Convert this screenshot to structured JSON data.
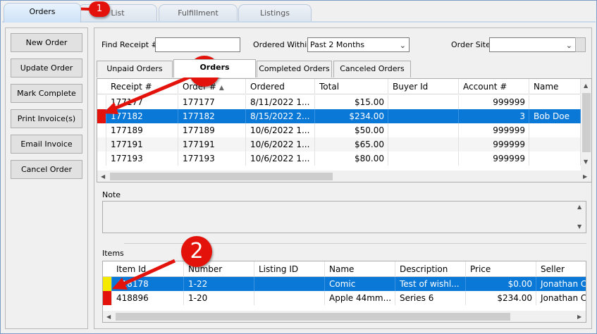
{
  "top_tabs": [
    "Orders",
    "List",
    "Fulfillment",
    "Listings"
  ],
  "left_buttons": [
    "New Order",
    "Update Order",
    "Mark Complete",
    "Print Invoice(s)",
    "Email Invoice",
    "Cancel Order"
  ],
  "filters": {
    "find_receipt_label": "Find Receipt #",
    "find_receipt_value": "",
    "ordered_within_label": "Ordered Within",
    "ordered_within_value": "Past 2 Months",
    "order_site_label": "Order Site",
    "order_site_value": ""
  },
  "order_tabs": [
    "Unpaid Orders",
    "Orders",
    "Completed Orders",
    "Canceled Orders"
  ],
  "orders_columns": [
    "Receipt #",
    "Order #",
    "Ordered",
    "Total",
    "Buyer Id",
    "Account #",
    "Name"
  ],
  "orders_rows": [
    {
      "receipt": "177177",
      "order": "177177",
      "ordered": "8/11/2022 1...",
      "total": "$15.00",
      "buyer": "",
      "account": "999999",
      "name": ""
    },
    {
      "receipt": "177182",
      "order": "177182",
      "ordered": "8/15/2022 2...",
      "total": "$234.00",
      "buyer": "",
      "account": "3",
      "name": "Bob Doe"
    },
    {
      "receipt": "177189",
      "order": "177189",
      "ordered": "10/6/2022 1...",
      "total": "$50.00",
      "buyer": "",
      "account": "999999",
      "name": ""
    },
    {
      "receipt": "177191",
      "order": "177191",
      "ordered": "10/6/2022 1...",
      "total": "$65.00",
      "buyer": "",
      "account": "999999",
      "name": ""
    },
    {
      "receipt": "177193",
      "order": "177193",
      "ordered": "10/6/2022 1...",
      "total": "$80.00",
      "buyer": "",
      "account": "999999",
      "name": ""
    }
  ],
  "note_label": "Note",
  "items_label": "Items",
  "items_columns": [
    "Item Id",
    "Number",
    "Listing ID",
    "Name",
    "Description",
    "Price",
    "Seller"
  ],
  "items_rows": [
    {
      "id": "418178",
      "number": "1-22",
      "listing": "",
      "name": "Comic",
      "description": "Test of wishl...",
      "price": "$0.00",
      "seller": "Jonathan C"
    },
    {
      "id": "418896",
      "number": "1-20",
      "listing": "",
      "name": "Apple 44mm...",
      "description": "Series 6",
      "price": "$234.00",
      "seller": "Jonathan C"
    }
  ],
  "callouts": [
    "1",
    "2",
    "2"
  ],
  "colors": {
    "selection": "#0a78d7",
    "marker_red": "#e3120b",
    "marker_yellow": "#f5e900"
  }
}
